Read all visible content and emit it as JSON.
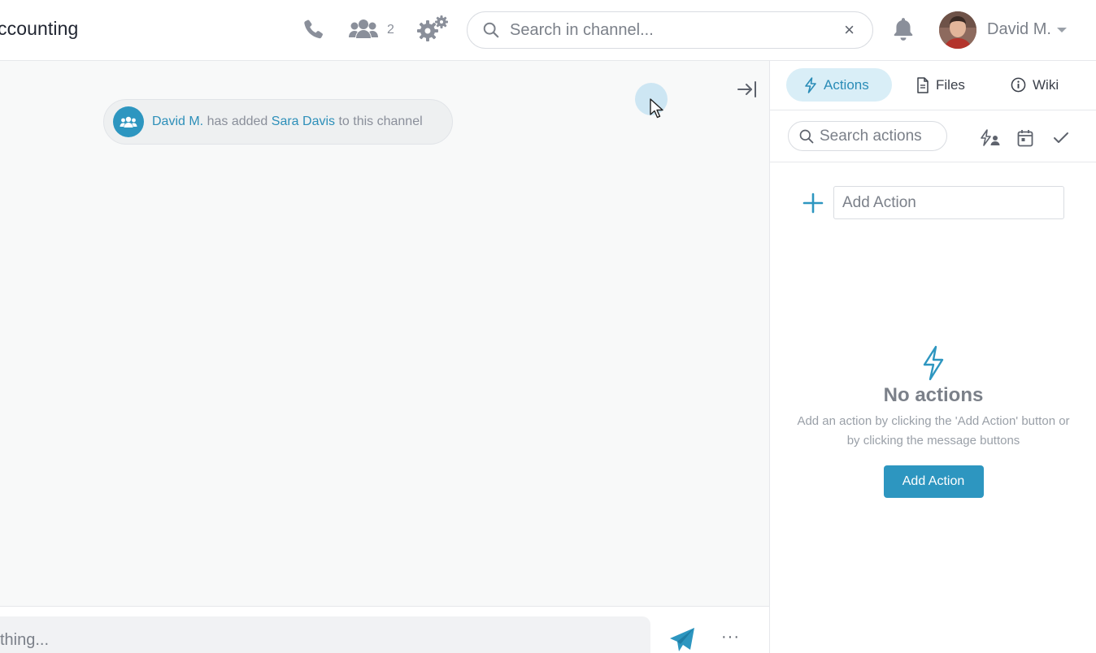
{
  "header": {
    "channel_title": "ccounting",
    "member_count": "2",
    "search_placeholder": "Search in channel...",
    "clear_label": "×",
    "user_name": "David M."
  },
  "chat": {
    "system_message": {
      "actor": "David M.",
      "verb": "has added",
      "target": "Sara Davis",
      "suffix": "to this channel"
    },
    "composer_placeholder": "thing...",
    "more_label": "···"
  },
  "panel": {
    "tabs": [
      {
        "label": "Actions",
        "active": true
      },
      {
        "label": "Files",
        "active": false
      },
      {
        "label": "Wiki",
        "active": false
      }
    ],
    "search_placeholder": "Search actions",
    "add_action_placeholder": "Add Action",
    "empty_state": {
      "title": "No actions",
      "description": "Add an action by clicking the 'Add Action' button or by clicking the message buttons",
      "button_label": "Add Action"
    }
  },
  "colors": {
    "accent": "#2d96c0",
    "link": "#2d8fb9",
    "icon_gray": "#8a8f9a",
    "active_tab_bg": "#d9eef7"
  },
  "icons": [
    "phone-icon",
    "users-icon",
    "gears-icon",
    "search-icon",
    "close-icon",
    "bell-icon",
    "chevron-down-icon",
    "collapse-panel-icon",
    "group-icon",
    "send-icon",
    "bolt-icon",
    "file-icon",
    "info-icon",
    "assign-action-icon",
    "calendar-icon",
    "check-icon",
    "plus-icon"
  ]
}
